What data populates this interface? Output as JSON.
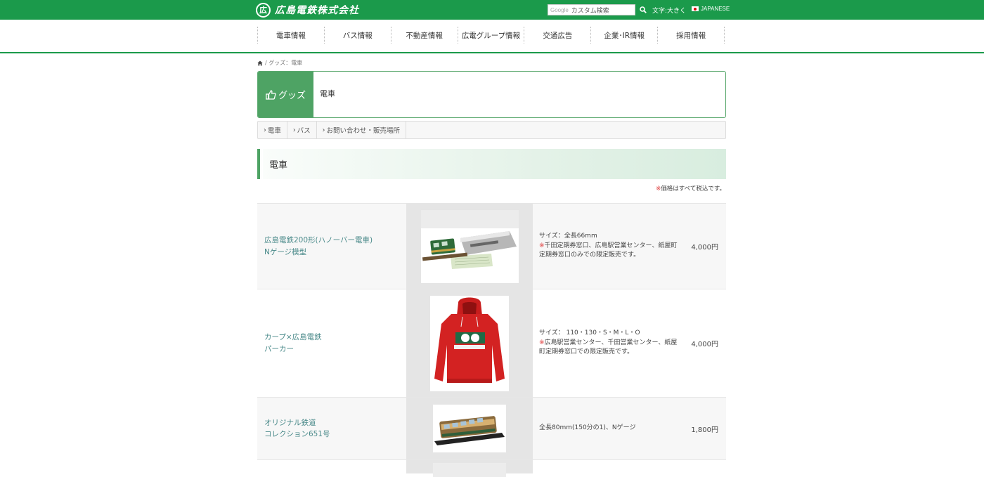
{
  "header": {
    "logo_text": "広島電鉄株式会社",
    "logo_mark": "広",
    "search_brand": "Google",
    "search_placeholder": "カスタム検索",
    "font_size_label": "文字:大きく",
    "language_label": "JAPANESE"
  },
  "nav": {
    "items": [
      "電車情報",
      "バス情報",
      "不動産情報",
      "広電グループ情報",
      "交通広告",
      "企業･IR情報",
      "採用情報"
    ]
  },
  "breadcrumb": {
    "path": "/ グッズ：電車"
  },
  "category": {
    "label": "グッズ",
    "title": "電車"
  },
  "subnav": {
    "items": [
      "電車",
      "バス",
      "お問い合わせ・販売場所"
    ]
  },
  "section": {
    "title": "電車",
    "tax_mark": "※",
    "tax_note": "価格はすべて税込です。"
  },
  "products": [
    {
      "name_line1": "広島電鉄200形(ハノーバー電車)",
      "name_line2": "Nゲージ模型",
      "spec": "サイズ：全長66mm",
      "mark": "※",
      "note": "千田定期券窓口、広島駅営業センター、紙屋町定期券窓口のみでの限定販売です。",
      "price": "4,000円"
    },
    {
      "name_line1": "カープ×広島電鉄",
      "name_line2": "パーカー",
      "spec": "サイズ： 110・130・S・M・L・O",
      "mark": "※",
      "note": "広島駅営業センター、千田営業センター、紙屋町定期券窓口での限定販売です。",
      "price": "4,000円"
    },
    {
      "name_line1": "オリジナル鉄道",
      "name_line2": "コレクション651号",
      "spec": "全長80mm(150分の1)、Nゲージ",
      "mark": "",
      "note": "",
      "price": "1,800円"
    }
  ],
  "colors": {
    "brand_green": "#1b9a4b",
    "label_green": "#4ea364",
    "link_teal": "#4a8a8a",
    "note_red": "#d33333"
  }
}
